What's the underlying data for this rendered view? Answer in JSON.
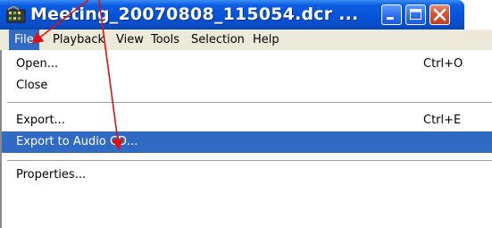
{
  "window": {
    "title": "Meeting_20070808_115054.dcr ...",
    "icon": "camtasia-filmstrip-icon",
    "controls": [
      "minimize-icon",
      "maximize-icon",
      "close-icon"
    ]
  },
  "menubar": {
    "items": [
      {
        "label": "File",
        "active": true
      },
      {
        "label": "Playback"
      },
      {
        "label": "View"
      },
      {
        "label": "Tools"
      },
      {
        "label": "Selection"
      },
      {
        "label": "Help"
      }
    ]
  },
  "file_menu": {
    "items": [
      {
        "label": "Open...",
        "shortcut": "Ctrl+O"
      },
      {
        "label": "Close",
        "shortcut": ""
      },
      {
        "label": "Export...",
        "shortcut": "Ctrl+E"
      },
      {
        "label": "Export to Audio CD...",
        "shortcut": "",
        "highlighted": true
      },
      {
        "label": "Properties...",
        "shortcut": ""
      }
    ]
  },
  "colors": {
    "titlebar": "#0553d8",
    "highlight": "#316ac5",
    "menubar_bg": "#ece9d8",
    "annotation_arrow": "#e01010"
  }
}
